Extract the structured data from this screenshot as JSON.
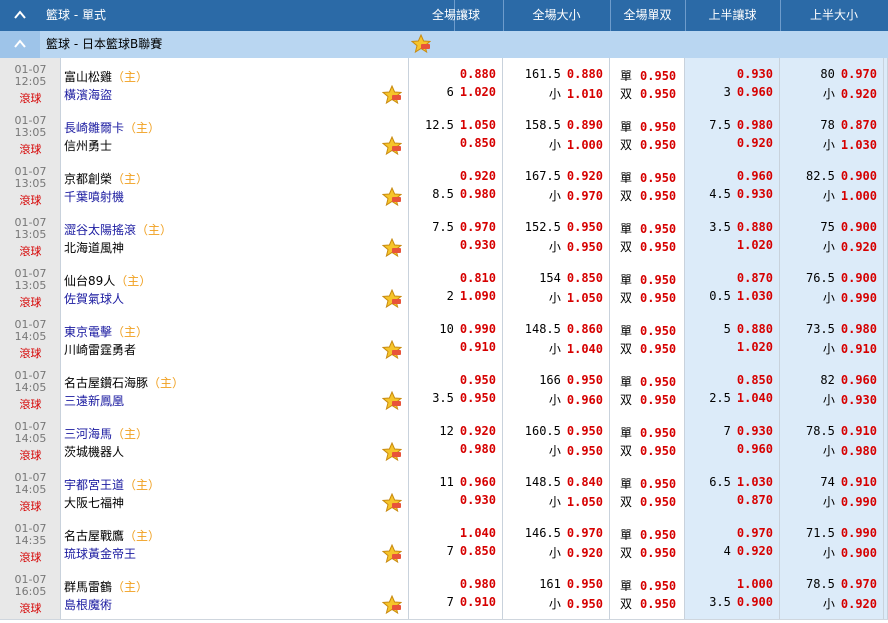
{
  "header": {
    "title": "籃球 - 單式",
    "columns": [
      "全場讓球",
      "全場大小",
      "全場單双",
      "上半讓球",
      "上半大小"
    ]
  },
  "league": {
    "name": "籃球 - 日本籃球B聯賽"
  },
  "colors": {
    "header_bg": "#2b6aa7",
    "league_bg": "#b9d6f1",
    "odds": "#d60000",
    "home_tag": "#f0a020"
  },
  "labels": {
    "home": "（主）",
    "live": "滾球",
    "small": "小",
    "odd": "單",
    "even": "双"
  },
  "matches": [
    {
      "date": "01-07",
      "time": "12:05",
      "t1": "富山松雞",
      "t1_color": "#000",
      "t2": "橫濱海盜",
      "t2_color": "#1a1aa0",
      "home": 1,
      "hcp": {
        "l1": {
          "h": "",
          "o": "0.880"
        },
        "l2": {
          "h": "6",
          "o": "1.020"
        }
      },
      "ou": {
        "l1": {
          "h": "161.5",
          "o": "0.880"
        },
        "l2": {
          "h": "小",
          "o": "1.010"
        }
      },
      "oe": [
        "0.950",
        "0.950"
      ],
      "h1hcp": {
        "l1": {
          "h": "",
          "o": "0.930"
        },
        "l2": {
          "h": "3",
          "o": "0.960"
        }
      },
      "h1ou": {
        "l1": {
          "h": "80",
          "o": "0.970"
        },
        "l2": {
          "h": "小",
          "o": "0.920"
        }
      }
    },
    {
      "date": "01-07",
      "time": "13:05",
      "t1": "長崎雛爾卡",
      "t1_color": "#1a1aa0",
      "t2": "信州勇士",
      "t2_color": "#000",
      "home": 1,
      "hcp": {
        "l1": {
          "h": "12.5",
          "o": "1.050"
        },
        "l2": {
          "h": "",
          "o": "0.850"
        }
      },
      "ou": {
        "l1": {
          "h": "158.5",
          "o": "0.890"
        },
        "l2": {
          "h": "小",
          "o": "1.000"
        }
      },
      "oe": [
        "0.950",
        "0.950"
      ],
      "h1hcp": {
        "l1": {
          "h": "7.5",
          "o": "0.980"
        },
        "l2": {
          "h": "",
          "o": "0.920"
        }
      },
      "h1ou": {
        "l1": {
          "h": "78",
          "o": "0.870"
        },
        "l2": {
          "h": "小",
          "o": "1.030"
        }
      }
    },
    {
      "date": "01-07",
      "time": "13:05",
      "t1": "京都創榮",
      "t1_color": "#000",
      "t2": "千葉噴射機",
      "t2_color": "#1a1aa0",
      "home": 1,
      "hcp": {
        "l1": {
          "h": "",
          "o": "0.920"
        },
        "l2": {
          "h": "8.5",
          "o": "0.980"
        }
      },
      "ou": {
        "l1": {
          "h": "167.5",
          "o": "0.920"
        },
        "l2": {
          "h": "小",
          "o": "0.970"
        }
      },
      "oe": [
        "0.950",
        "0.950"
      ],
      "h1hcp": {
        "l1": {
          "h": "",
          "o": "0.960"
        },
        "l2": {
          "h": "4.5",
          "o": "0.930"
        }
      },
      "h1ou": {
        "l1": {
          "h": "82.5",
          "o": "0.900"
        },
        "l2": {
          "h": "小",
          "o": "1.000"
        }
      }
    },
    {
      "date": "01-07",
      "time": "13:05",
      "t1": "澀谷太陽搖滾",
      "t1_color": "#1a1aa0",
      "t2": "北海道風神",
      "t2_color": "#000",
      "home": 1,
      "hcp": {
        "l1": {
          "h": "7.5",
          "o": "0.970"
        },
        "l2": {
          "h": "",
          "o": "0.930"
        }
      },
      "ou": {
        "l1": {
          "h": "152.5",
          "o": "0.950"
        },
        "l2": {
          "h": "小",
          "o": "0.950"
        }
      },
      "oe": [
        "0.950",
        "0.950"
      ],
      "h1hcp": {
        "l1": {
          "h": "3.5",
          "o": "0.880"
        },
        "l2": {
          "h": "",
          "o": "1.020"
        }
      },
      "h1ou": {
        "l1": {
          "h": "75",
          "o": "0.900"
        },
        "l2": {
          "h": "小",
          "o": "0.920"
        }
      }
    },
    {
      "date": "01-07",
      "time": "13:05",
      "t1": "仙台89人",
      "t1_color": "#000",
      "t2": "佐賀氣球人",
      "t2_color": "#1a1aa0",
      "home": 1,
      "hcp": {
        "l1": {
          "h": "",
          "o": "0.810"
        },
        "l2": {
          "h": "2",
          "o": "1.090"
        }
      },
      "ou": {
        "l1": {
          "h": "154",
          "o": "0.850"
        },
        "l2": {
          "h": "小",
          "o": "1.050"
        }
      },
      "oe": [
        "0.950",
        "0.950"
      ],
      "h1hcp": {
        "l1": {
          "h": "",
          "o": "0.870"
        },
        "l2": {
          "h": "0.5",
          "o": "1.030"
        }
      },
      "h1ou": {
        "l1": {
          "h": "76.5",
          "o": "0.900"
        },
        "l2": {
          "h": "小",
          "o": "0.990"
        }
      }
    },
    {
      "date": "01-07",
      "time": "14:05",
      "t1": "東京電擊",
      "t1_color": "#1a1aa0",
      "t2": "川崎雷霆勇者",
      "t2_color": "#000",
      "home": 1,
      "hcp": {
        "l1": {
          "h": "10",
          "o": "0.990"
        },
        "l2": {
          "h": "",
          "o": "0.910"
        }
      },
      "ou": {
        "l1": {
          "h": "148.5",
          "o": "0.860"
        },
        "l2": {
          "h": "小",
          "o": "1.040"
        }
      },
      "oe": [
        "0.950",
        "0.950"
      ],
      "h1hcp": {
        "l1": {
          "h": "5",
          "o": "0.880"
        },
        "l2": {
          "h": "",
          "o": "1.020"
        }
      },
      "h1ou": {
        "l1": {
          "h": "73.5",
          "o": "0.980"
        },
        "l2": {
          "h": "小",
          "o": "0.910"
        }
      }
    },
    {
      "date": "01-07",
      "time": "14:05",
      "t1": "名古屋鑽石海豚",
      "t1_color": "#000",
      "t2": "三遠新鳳凰",
      "t2_color": "#1a1aa0",
      "home": 1,
      "hcp": {
        "l1": {
          "h": "",
          "o": "0.950"
        },
        "l2": {
          "h": "3.5",
          "o": "0.950"
        }
      },
      "ou": {
        "l1": {
          "h": "166",
          "o": "0.950"
        },
        "l2": {
          "h": "小",
          "o": "0.960"
        }
      },
      "oe": [
        "0.950",
        "0.950"
      ],
      "h1hcp": {
        "l1": {
          "h": "",
          "o": "0.850"
        },
        "l2": {
          "h": "2.5",
          "o": "1.040"
        }
      },
      "h1ou": {
        "l1": {
          "h": "82",
          "o": "0.960"
        },
        "l2": {
          "h": "小",
          "o": "0.930"
        }
      }
    },
    {
      "date": "01-07",
      "time": "14:05",
      "t1": "三河海馬",
      "t1_color": "#1a1aa0",
      "t2": "茨城機器人",
      "t2_color": "#000",
      "home": 1,
      "hcp": {
        "l1": {
          "h": "12",
          "o": "0.920"
        },
        "l2": {
          "h": "",
          "o": "0.980"
        }
      },
      "ou": {
        "l1": {
          "h": "160.5",
          "o": "0.950"
        },
        "l2": {
          "h": "小",
          "o": "0.950"
        }
      },
      "oe": [
        "0.950",
        "0.950"
      ],
      "h1hcp": {
        "l1": {
          "h": "7",
          "o": "0.930"
        },
        "l2": {
          "h": "",
          "o": "0.960"
        }
      },
      "h1ou": {
        "l1": {
          "h": "78.5",
          "o": "0.910"
        },
        "l2": {
          "h": "小",
          "o": "0.980"
        }
      }
    },
    {
      "date": "01-07",
      "time": "14:05",
      "t1": "宇都宮王道",
      "t1_color": "#1a1aa0",
      "t2": "大阪七福神",
      "t2_color": "#000",
      "home": 1,
      "hcp": {
        "l1": {
          "h": "11",
          "o": "0.960"
        },
        "l2": {
          "h": "",
          "o": "0.930"
        }
      },
      "ou": {
        "l1": {
          "h": "148.5",
          "o": "0.840"
        },
        "l2": {
          "h": "小",
          "o": "1.050"
        }
      },
      "oe": [
        "0.950",
        "0.950"
      ],
      "h1hcp": {
        "l1": {
          "h": "6.5",
          "o": "1.030"
        },
        "l2": {
          "h": "",
          "o": "0.870"
        }
      },
      "h1ou": {
        "l1": {
          "h": "74",
          "o": "0.910"
        },
        "l2": {
          "h": "小",
          "o": "0.990"
        }
      }
    },
    {
      "date": "01-07",
      "time": "14:35",
      "t1": "名古屋戰鷹",
      "t1_color": "#000",
      "t2": "琉球黃金帝王",
      "t2_color": "#1a1aa0",
      "home": 1,
      "hcp": {
        "l1": {
          "h": "",
          "o": "1.040"
        },
        "l2": {
          "h": "7",
          "o": "0.850"
        }
      },
      "ou": {
        "l1": {
          "h": "146.5",
          "o": "0.970"
        },
        "l2": {
          "h": "小",
          "o": "0.920"
        }
      },
      "oe": [
        "0.950",
        "0.950"
      ],
      "h1hcp": {
        "l1": {
          "h": "",
          "o": "0.970"
        },
        "l2": {
          "h": "4",
          "o": "0.920"
        }
      },
      "h1ou": {
        "l1": {
          "h": "71.5",
          "o": "0.990"
        },
        "l2": {
          "h": "小",
          "o": "0.900"
        }
      }
    },
    {
      "date": "01-07",
      "time": "16:05",
      "t1": "群馬雷鶴",
      "t1_color": "#000",
      "t2": "島根魔術",
      "t2_color": "#1a1aa0",
      "home": 1,
      "hcp": {
        "l1": {
          "h": "",
          "o": "0.980"
        },
        "l2": {
          "h": "7",
          "o": "0.910"
        }
      },
      "ou": {
        "l1": {
          "h": "161",
          "o": "0.950"
        },
        "l2": {
          "h": "小",
          "o": "0.950"
        }
      },
      "oe": [
        "0.950",
        "0.950"
      ],
      "h1hcp": {
        "l1": {
          "h": "",
          "o": "1.000"
        },
        "l2": {
          "h": "3.5",
          "o": "0.900"
        }
      },
      "h1ou": {
        "l1": {
          "h": "78.5",
          "o": "0.970"
        },
        "l2": {
          "h": "小",
          "o": "0.920"
        }
      }
    }
  ]
}
